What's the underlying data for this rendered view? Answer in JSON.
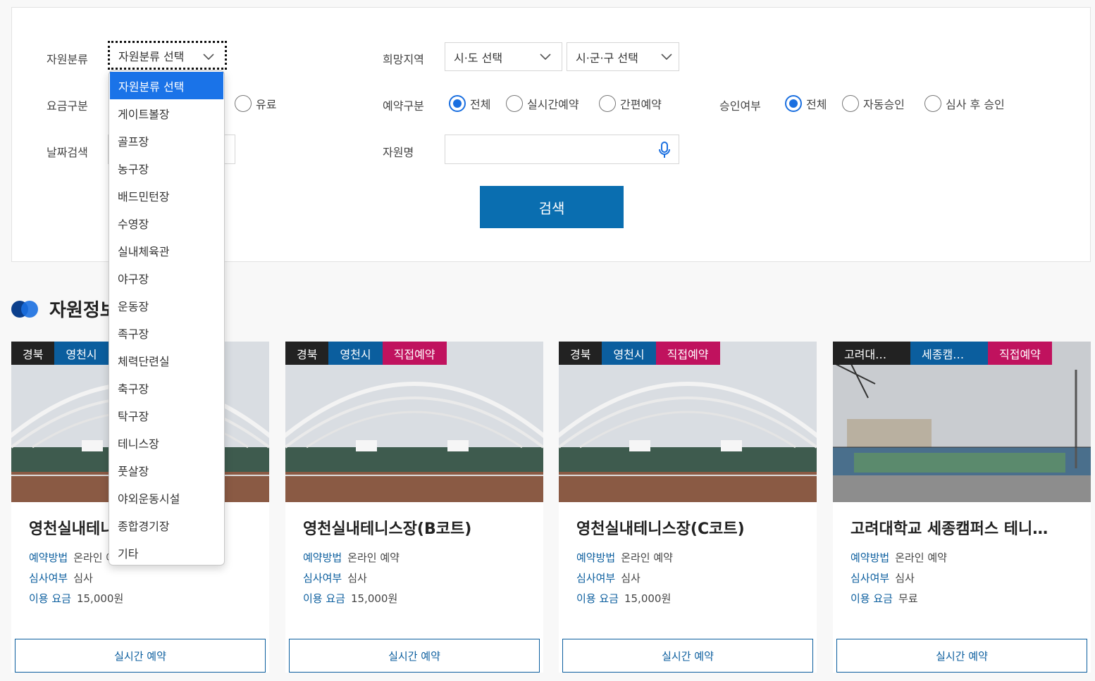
{
  "filters": {
    "resource_type": {
      "label": "자원분류",
      "selected": "자원분류 선택"
    },
    "region": {
      "label": "희망지역",
      "sido": "시·도 선택",
      "sigungu": "시·군·구 선택"
    },
    "fee": {
      "label": "요금구분",
      "options": [
        "유료"
      ]
    },
    "reservation_type": {
      "label": "예약구분",
      "options": [
        "전체",
        "실시간예약",
        "간편예약"
      ],
      "selected": "전체"
    },
    "approval": {
      "label": "승인여부",
      "options": [
        "전체",
        "자동승인",
        "심사 후 승인"
      ],
      "selected": "전체"
    },
    "date": {
      "label": "날짜검색"
    },
    "name": {
      "label": "자원명",
      "value": ""
    },
    "search_label": "검색"
  },
  "section": {
    "title": "자원정보"
  },
  "dropdown": {
    "options": [
      "자원분류 선택",
      "게이트볼장",
      "골프장",
      "농구장",
      "배드민턴장",
      "수영장",
      "실내체육관",
      "야구장",
      "운동장",
      "족구장",
      "체력단련실",
      "축구장",
      "탁구장",
      "테니스장",
      "풋살장",
      "야외운동시설",
      "종합경기장",
      "기타"
    ],
    "selected_index": 0
  },
  "cards": [
    {
      "region": "경북",
      "city": "영천시",
      "direct": "",
      "name": "영천실내테니스장(A코트)",
      "method_k": "예약방법",
      "method_v": "온라인 예약",
      "review_k": "심사여부",
      "review_v": "심사",
      "fee_k": "이용 요금",
      "fee_v": "15,000원",
      "button": "실시간 예약"
    },
    {
      "region": "경북",
      "city": "영천시",
      "direct": "직접예약",
      "name": "영천실내테니스장(B코트)",
      "method_k": "예약방법",
      "method_v": "온라인 예약",
      "review_k": "심사여부",
      "review_v": "심사",
      "fee_k": "이용 요금",
      "fee_v": "15,000원",
      "button": "실시간 예약"
    },
    {
      "region": "경북",
      "city": "영천시",
      "direct": "직접예약",
      "name": "영천실내테니스장(C코트)",
      "method_k": "예약방법",
      "method_v": "온라인 예약",
      "review_k": "심사여부",
      "review_v": "심사",
      "fee_k": "이용 요금",
      "fee_v": "15,000원",
      "button": "실시간 예약"
    },
    {
      "region": "고려대…",
      "city": "세종캠…",
      "direct": "직접예약",
      "name": "고려대학교 세종캠퍼스 테니…",
      "method_k": "예약방법",
      "method_v": "온라인 예약",
      "review_k": "심사여부",
      "review_v": "심사",
      "fee_k": "이용 요금",
      "fee_v": "무료",
      "button": "실시간 예약"
    }
  ],
  "colors": {
    "accent": "#0a6eb0",
    "tag_direct": "#c0125e",
    "tag_city": "#0b5e9e",
    "selected_option": "#1a73e8"
  }
}
